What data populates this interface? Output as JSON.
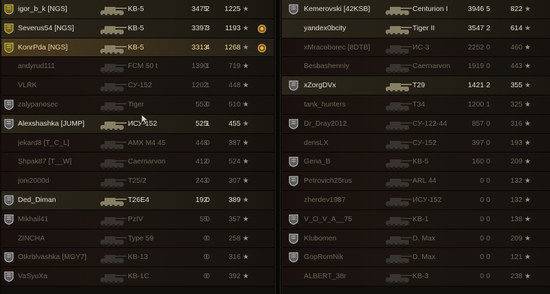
{
  "left_team": [
    {
      "rank": "gold",
      "name": "igor_b_k [NGS]",
      "vehicle": "KB-5",
      "score": "3475",
      "kills": "2",
      "xp": "1225",
      "state": "alive",
      "medal": ""
    },
    {
      "rank": "gold",
      "name": "Severus54 [NGS]",
      "vehicle": "KB-5",
      "score": "3397",
      "kills": "3",
      "xp": "1193",
      "state": "alive",
      "medal": "medal"
    },
    {
      "rank": "gold",
      "name": "KonrPda [NGS]",
      "vehicle": "KB-5",
      "score": "3313",
      "kills": "4",
      "xp": "1268",
      "state": "self",
      "medal": "medal"
    },
    {
      "rank": "",
      "name": "andyrud111",
      "vehicle": "FCM 50 t",
      "score": "1390",
      "kills": "1",
      "xp": "719",
      "state": "dead",
      "medal": ""
    },
    {
      "rank": "",
      "name": "VLRK",
      "vehicle": "СУ-152",
      "score": "1202",
      "kills": "1",
      "xp": "448",
      "state": "dead",
      "medal": ""
    },
    {
      "rank": "silver",
      "name": "zalypanosec",
      "vehicle": "Tiger",
      "score": "553",
      "kills": "0",
      "xp": "510",
      "state": "dead",
      "medal": ""
    },
    {
      "rank": "silver",
      "name": "Alexshashka [JUMP]",
      "vehicle": "ИСУ-152",
      "score": "525",
      "kills": "1",
      "xp": "455",
      "state": "alive",
      "medal": ""
    },
    {
      "rank": "",
      "name": "jekard8 [T_C_L]",
      "vehicle": "AMX M4 45",
      "score": "448",
      "kills": "0",
      "xp": "387",
      "state": "dead",
      "medal": ""
    },
    {
      "rank": "",
      "name": "Shpak87 [T__W]",
      "vehicle": "Caernarvon",
      "score": "412",
      "kills": "0",
      "xp": "524",
      "state": "dead",
      "medal": ""
    },
    {
      "rank": "",
      "name": "joni2000d",
      "vehicle": "T25/2",
      "score": "243",
      "kills": "0",
      "xp": "307",
      "state": "dead",
      "medal": ""
    },
    {
      "rank": "silver",
      "name": "Ded_Diman",
      "vehicle": "T26E4",
      "score": "192",
      "kills": "0",
      "xp": "389",
      "state": "alive",
      "medal": ""
    },
    {
      "rank": "silver",
      "name": "Mikhail41",
      "vehicle": "PzIV",
      "score": "55",
      "kills": "0",
      "xp": "357",
      "state": "dead",
      "medal": ""
    },
    {
      "rank": "",
      "name": "ZINCHA",
      "vehicle": "Type 59",
      "score": "0",
      "kills": "0",
      "xp": "258",
      "state": "dead",
      "medal": ""
    },
    {
      "rank": "silver",
      "name": "Otkrblvashka [MGY7]",
      "vehicle": "KB-13",
      "score": "0",
      "kills": "0",
      "xp": "316",
      "state": "dead",
      "medal": ""
    },
    {
      "rank": "silver",
      "name": "VaSyuXa",
      "vehicle": "KB-1C",
      "score": "0",
      "kills": "0",
      "xp": "392",
      "state": "dead",
      "medal": ""
    }
  ],
  "right_team": [
    {
      "rank": "silver",
      "name": "Kemerovski [42KSB]",
      "vehicle": "Centurion I",
      "score": "3946",
      "kills": "5",
      "xp": "822",
      "state": "alive"
    },
    {
      "rank": "",
      "name": "yandex0bcity",
      "vehicle": "Tiger II",
      "score": "3547",
      "kills": "2",
      "xp": "614",
      "state": "alive"
    },
    {
      "rank": "",
      "name": "xMracoborec [8DTB]",
      "vehicle": "ИС-3",
      "score": "2252",
      "kills": "0",
      "xp": "460",
      "state": "dead"
    },
    {
      "rank": "",
      "name": "Besbashenniy",
      "vehicle": "Caernarvon",
      "score": "1919",
      "kills": "0",
      "xp": "443",
      "state": "dead"
    },
    {
      "rank": "silver",
      "name": "xZorgDVx",
      "vehicle": "T29",
      "score": "1421",
      "kills": "2",
      "xp": "355",
      "state": "alive"
    },
    {
      "rank": "",
      "name": "tank_hunters",
      "vehicle": "T34",
      "score": "1200",
      "kills": "1",
      "xp": "325",
      "state": "dead"
    },
    {
      "rank": "silver",
      "name": "Dr_Dray2012",
      "vehicle": "СУ-122-44",
      "score": "857",
      "kills": "0",
      "xp": "316",
      "state": "dead"
    },
    {
      "rank": "",
      "name": "densLX",
      "vehicle": "СУ-152",
      "score": "397",
      "kills": "0",
      "xp": "193",
      "state": "dead"
    },
    {
      "rank": "silver",
      "name": "Gena_B",
      "vehicle": "KB-5",
      "score": "160",
      "kills": "0",
      "xp": "209",
      "state": "dead"
    },
    {
      "rank": "silver",
      "name": "Petrovich25rus",
      "vehicle": "ARL 44",
      "score": "0",
      "kills": "0",
      "xp": "132",
      "state": "dead"
    },
    {
      "rank": "",
      "name": "zherdev1987",
      "vehicle": "ИСУ-152",
      "score": "0",
      "kills": "0",
      "xp": "132",
      "state": "dead"
    },
    {
      "rank": "silver",
      "name": "V_O_V_A__75",
      "vehicle": "KB-1",
      "score": "0",
      "kills": "0",
      "xp": "138",
      "state": "dead"
    },
    {
      "rank": "silver",
      "name": "Klubomen",
      "vehicle": "D. Max",
      "score": "0",
      "kills": "0",
      "xp": "209",
      "state": "dead"
    },
    {
      "rank": "silver",
      "name": "GopRomNik",
      "vehicle": "D. Max",
      "score": "0",
      "kills": "0",
      "xp": "121",
      "state": "dead"
    },
    {
      "rank": "",
      "name": "ALBERT_38r",
      "vehicle": "KB-3",
      "score": "0",
      "kills": "0",
      "xp": "238",
      "state": "dead"
    }
  ],
  "icons": {
    "star": "★",
    "rank_icon": "shield-rank-icon",
    "tank_icon": "tank-silhouette-icon",
    "medal_icon": "medal-icon"
  },
  "colors": {
    "gold_rank": "#c9b44a",
    "silver_rank": "#b9b9b9",
    "alive_text": "#e4dfd2",
    "dead_text": "#6b665c",
    "self_highlight": "#4a3a1f"
  }
}
